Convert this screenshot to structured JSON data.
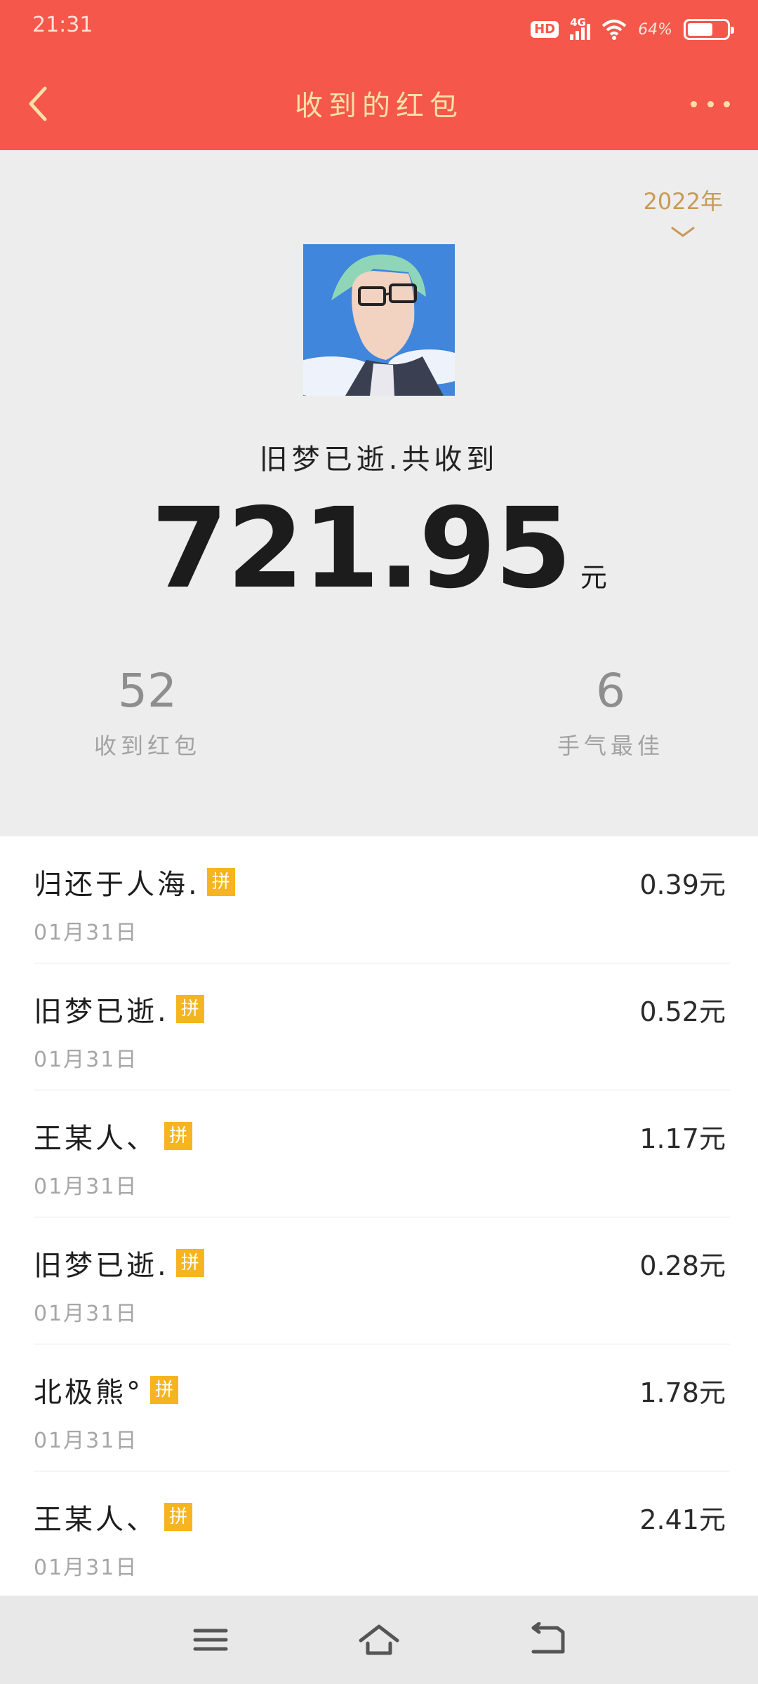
{
  "status_bar": {
    "time": "21:31",
    "hd": "HD",
    "network": "4G",
    "battery_percent": "64%",
    "battery_level": 0.64
  },
  "header": {
    "title": "收到的红包",
    "back_icon": "chevron-left-icon",
    "more_icon": "more-dots-icon"
  },
  "summary": {
    "year": "2022年",
    "owner_label": "旧梦已逝.共收到",
    "total_amount": "721.95",
    "currency": "元",
    "stats": {
      "received_count": "52",
      "received_label": "收到红包",
      "best_luck_count": "6",
      "best_luck_label": "手气最佳"
    }
  },
  "list": [
    {
      "name": "归还于人海.",
      "badge": "拼",
      "amount": "0.39元",
      "date": "01月31日"
    },
    {
      "name": "旧梦已逝.",
      "badge": "拼",
      "amount": "0.52元",
      "date": "01月31日"
    },
    {
      "name": "王某人、",
      "badge": "拼",
      "amount": "1.17元",
      "date": "01月31日"
    },
    {
      "name": "旧梦已逝.",
      "badge": "拼",
      "amount": "0.28元",
      "date": "01月31日"
    },
    {
      "name": "北极熊°",
      "badge": "拼",
      "amount": "1.78元",
      "date": "01月31日"
    },
    {
      "name": "王某人、",
      "badge": "拼",
      "amount": "2.41元",
      "date": "01月31日"
    }
  ],
  "colors": {
    "header_bg": "#f5574a",
    "title_text": "#fbe0a6",
    "year_text": "#c79b56",
    "badge_bg": "#f6b520"
  }
}
